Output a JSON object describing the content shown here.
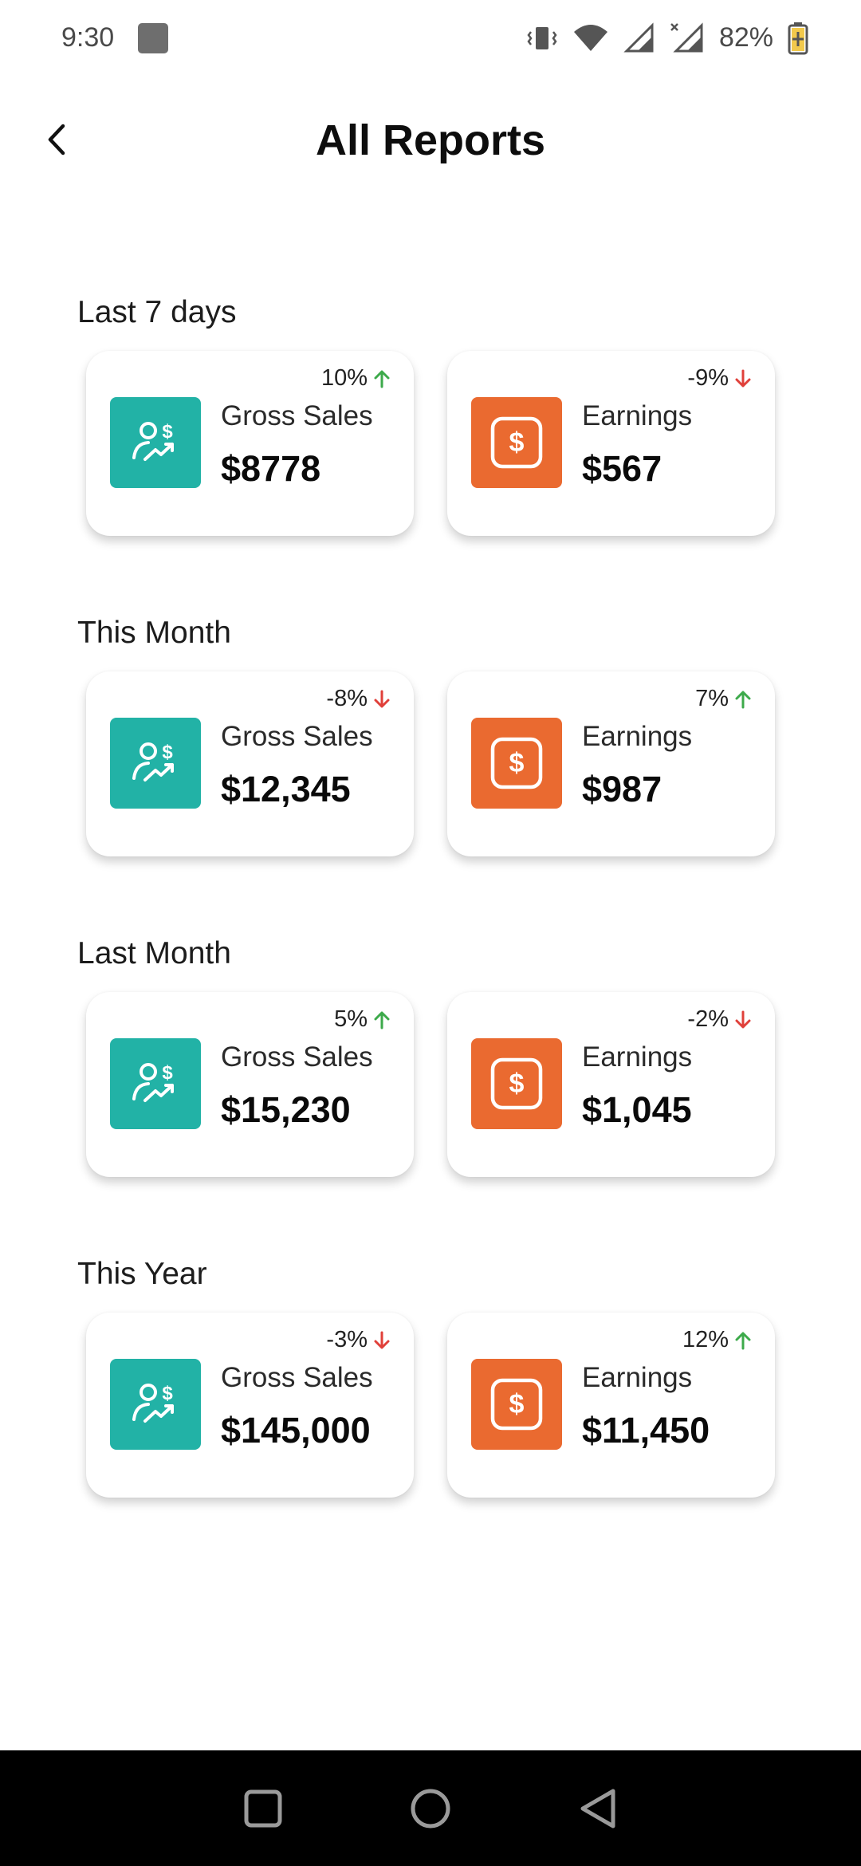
{
  "status_bar": {
    "time": "9:30",
    "battery": "82%"
  },
  "header": {
    "title": "All Reports"
  },
  "colors": {
    "sales": "#22B2A6",
    "earnings": "#EA6A30",
    "up": "#3DAA4B",
    "down": "#E0403A"
  },
  "icons": {
    "sales": "user-dollar-growth-icon",
    "earnings": "dollar-square-icon"
  },
  "sections": [
    {
      "title": "Last 7 days",
      "sales": {
        "label": "Gross Sales",
        "value": "$8778",
        "change": "10%",
        "direction": "up"
      },
      "earnings": {
        "label": "Earnings",
        "value": "$567",
        "change": "-9%",
        "direction": "down"
      }
    },
    {
      "title": "This Month",
      "sales": {
        "label": "Gross Sales",
        "value": "$12,345",
        "change": "-8%",
        "direction": "down"
      },
      "earnings": {
        "label": "Earnings",
        "value": "$987",
        "change": "7%",
        "direction": "up"
      }
    },
    {
      "title": "Last Month",
      "sales": {
        "label": "Gross Sales",
        "value": "$15,230",
        "change": "5%",
        "direction": "up"
      },
      "earnings": {
        "label": "Earnings",
        "value": "$1,045",
        "change": "-2%",
        "direction": "down"
      }
    },
    {
      "title": "This Year",
      "sales": {
        "label": "Gross Sales",
        "value": "$145,000",
        "change": "-3%",
        "direction": "down"
      },
      "earnings": {
        "label": "Earnings",
        "value": "$11,450",
        "change": "12%",
        "direction": "up"
      }
    }
  ]
}
